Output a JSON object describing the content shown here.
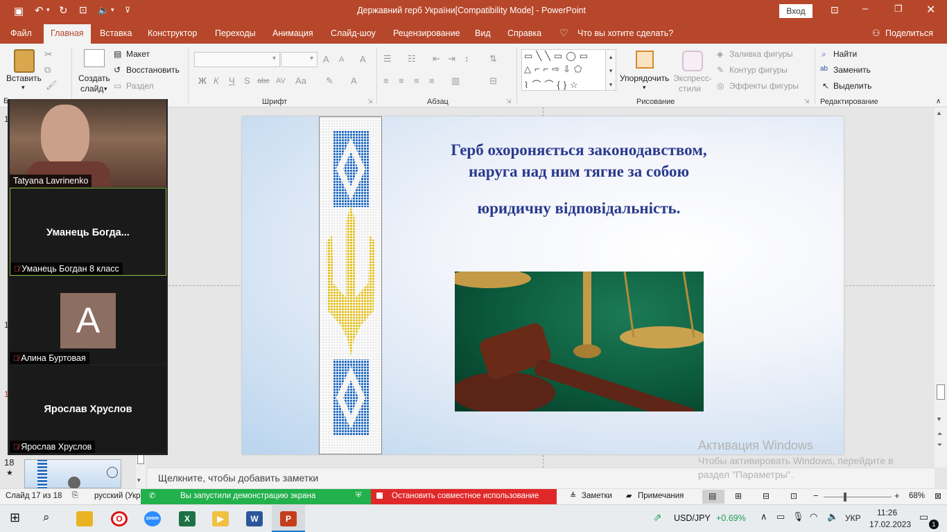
{
  "titlebar": {
    "title": "Державний герб України[Compatibility Mode]  -  PowerPoint",
    "signin": "Вход"
  },
  "tabs": {
    "file": "Файл",
    "home": "Главная",
    "insert": "Вставка",
    "design": "Конструктор",
    "transitions": "Переходы",
    "animations": "Анимация",
    "slideshow": "Слайд-шоу",
    "review": "Рецензирование",
    "view": "Вид",
    "help": "Справка",
    "tellme": "Что вы хотите сделать?",
    "share": "Поделиться"
  },
  "ribbon": {
    "paste": "Вставить",
    "new_slide_1": "Создать",
    "new_slide_2": "слайд",
    "layout": "Макет",
    "reset": "Восстановить",
    "section": "Раздел",
    "font_group": "Шрифт",
    "paragraph_group": "Абзац",
    "drawing_group": "Рисование",
    "editing_group": "Редактирование",
    "arrange": "Упорядочить",
    "styles_1": "Экспресс-",
    "styles_2": "стили",
    "fill": "Заливка фигуры",
    "outline": "Контур фигуры",
    "effects": "Эффекты фигуры",
    "find": "Найти",
    "replace": "Заменить",
    "select": "Выделить",
    "bold": "Ж",
    "italic": "К",
    "underline": "Ч",
    "shadow": "S",
    "strike": "abc",
    "spacing": "AV",
    "case": "Aa",
    "fontcolor": "A",
    "grow": "A",
    "shrink": "A",
    "clear": "A",
    "clipboard_letter": "Б"
  },
  "slide": {
    "title_line1": "Герб охороняється законодавством,",
    "title_line2": "наруга над ним тягне за собою",
    "title_line3": "юридичну відповідальність."
  },
  "participants": [
    {
      "name": "Tatyana Lavrinenko"
    },
    {
      "name": "Уманець Богдан 8 класс",
      "big": "Уманець  Богда..."
    },
    {
      "name": "Алина Буртовая",
      "avatar": "A"
    },
    {
      "name": "Ярослав Хруслов",
      "big": "Ярослав Хруслов"
    }
  ],
  "thumbs": {
    "num18": "18",
    "star": "★",
    "edge": [
      "1",
      "1",
      "1",
      "1"
    ]
  },
  "notes": {
    "placeholder": "Щелкните, чтобы добавить заметки"
  },
  "activation": {
    "title": "Активация Windows",
    "line1": "Чтобы активировать Windows, перейдите в",
    "line2": "раздел \"Параметры\"."
  },
  "status": {
    "slide": "Слайд 17 из 18",
    "lang": "русский (Укр",
    "sharing": "Вы запустили демонстрацию экрана",
    "stop": "Остановить совместное использование",
    "notes": "Заметки",
    "comments": "Примечания",
    "zoom": "68%"
  },
  "taskbar": {
    "ticker": "USD/JPY",
    "change": "+0.69%",
    "lang": "УКР",
    "time": "11:26",
    "date": "17.02.2023",
    "notif": "1"
  },
  "colors": {
    "accent": "#b7472a",
    "slide_title": "#2a3a8c"
  }
}
